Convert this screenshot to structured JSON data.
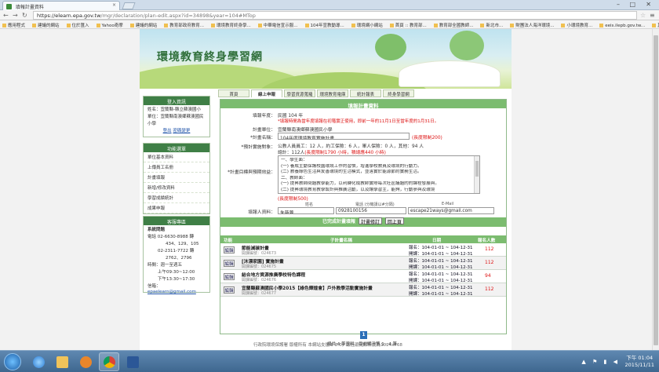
{
  "browser": {
    "tab_title": "填報計畫資料",
    "url_host": "https://elearn.epa.gov.tw",
    "url_path": "/mgr/declaration/plan-edit.aspx?id=34898&year=104#MTop",
    "bookmarks": [
      "應用程式",
      "建議的網站",
      "位於匯入",
      "Yahoo奇摩",
      "建議的網站",
      "教育部政府教育...",
      "環境教育終身學...",
      "中華電信宣示服...",
      "104年宣教動導...",
      "環境網小網站",
      "首頁 :: 教育部...",
      "教育部全國教師...",
      "新北市...",
      "財團法人海洋環境...",
      "小環境教育...",
      "eeis.ilepb.gov.tw...",
      "其他書籤"
    ]
  },
  "site": {
    "title": "環境教育終身學習網",
    "menu": [
      "首頁",
      "線上申報",
      "學習資源蒐羅",
      "環境教育電庫",
      "統計報表",
      "終身學習網"
    ]
  },
  "sidebar": {
    "login": {
      "header": "登入資訊",
      "lines": [
        "姓名：宜蘭縣-縣立蘇澳國小",
        "單位：宜蘭縣南澳鄉蘇澳國民",
        "小學"
      ],
      "links": [
        "登出",
        "密碼變更"
      ]
    },
    "functions": {
      "header": "功能選單",
      "items": [
        "單位基本資料",
        "上傳員工名冊",
        "計畫填報",
        "新增/修改資料",
        "學習成績統計",
        "成果申報"
      ]
    },
    "contact": {
      "header": "客服專區",
      "title": "系統問題",
      "phone": "電話 02-6630-8988 轉",
      "ext": "434、129、105",
      "fax1": "02-2311-7722 轉",
      "fax2": "2762、2796",
      "time_label": "時間：週一至週五",
      "time1": "上午09:30~12:00",
      "time2": "下午13:30~17:30",
      "email_label": "信箱：",
      "email": "epaelearn@gmail.com"
    }
  },
  "form": {
    "header": "填報計畫資料",
    "year_label": "填報年度：",
    "year_value": "民國 104 年",
    "year_note": "*填報時間為當年度填報在初階實正使用，即前一年的11月1日至當年度的1月31日。",
    "unit_label": "計畫單位：",
    "unit_value": "宜蘭縣南澳鄉蘇澳國民小學",
    "name_label": "*計畫名稱：",
    "name_value": "104年度環境教育實施計畫",
    "name_limit": "(長度限制200)",
    "people_label": "*預計實施對象：",
    "people_line1": "公教人員員工：12 人，約工保險：6 人，軍人保險：0 人，其他：94 人",
    "people_line2_prefix": "總計：112人",
    "people_line2_note": "(長度限制1790 小時，積總應440 小時)",
    "goal_label": "*計畫目標與預期效益：",
    "goal_lines": [
      "一、學生面：",
      "(一)  養成主動保護校園環境工作的習慣，增進學校教員及環境的行動力。",
      "(二)  教養綠色生活與友善環境的生活模式，並落實於能源節約實務生活。",
      "二、教師面：",
      "(一)  提昇教師問題教學能力，以利轉化成教師實際每次社區議題的的課程發展與。",
      "(二)  提昇環境教育教學設計與推廣活動，以及讓學習主，能夠，行動參與及環境"
    ],
    "goal_limit": "(長度限制500)",
    "contact_label": "填報人資料：",
    "col_name": "姓名",
    "col_phone": "電話 (分機請以#分隔)",
    "col_email": "E-Mail",
    "contact_name": "朱薇蓉",
    "contact_phone": "0928100156",
    "contact_email": "escape21ways@gmail.com",
    "done_text": "已完成計畫填報",
    "btn_modify": "計畫修訂",
    "btn_back": "回上頁"
  },
  "list": {
    "headers": [
      "功能",
      "子計畫名稱",
      "日期",
      "報名人數"
    ],
    "edit_label": "編輯",
    "rows": [
      {
        "name": "節能減碳計畫",
        "code": "開課編號：024673",
        "reg": "104-01-01 ~ 104-12-31",
        "open": "104-01-01 ~ 104-12-31",
        "count": "112"
      },
      {
        "name": "[沐漂家園] 實施計畫",
        "code": "開課編號：024675",
        "reg": "104-01-01 ~ 104-12-31",
        "open": "104-01-01 ~ 104-12-31",
        "count": "112"
      },
      {
        "name": "結合地方資源推廣學校特色課程",
        "code": "開課編號：024676",
        "reg": "104-01-01 ~ 104-12-31",
        "open": "104-01-01 ~ 104-12-31",
        "count": "94"
      },
      {
        "name": "宜蘭縣蘇澳國民小學2015【綠色輝煌會】戶外教學活動實施計畫",
        "code": "開課編號：024677",
        "reg": "104-01-01 ~ 104-12-31",
        "open": "104-01-01 ~ 104-12-31",
        "count": "112"
      }
    ],
    "reg_prefix": "報名：",
    "open_prefix": "開課：",
    "page": "1",
    "total_text": "總共 4 筆資料，目前顯示第 1 - 4 筆"
  },
  "footer": "行政院環境保護署 版權所有 本網站支援IE 8.0，最佳瀏覽解析度為1024x768",
  "taskbar": {
    "time": "下午 01:04",
    "date": "2015/11/11"
  }
}
